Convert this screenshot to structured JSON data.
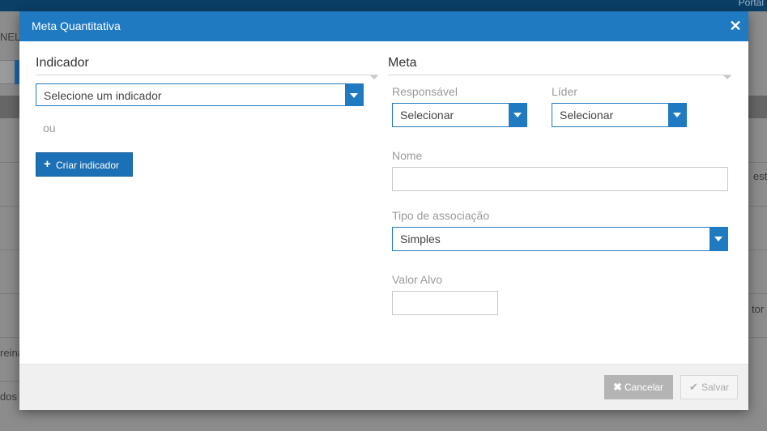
{
  "background": {
    "top_right_link": "Portal",
    "left_fragments": [
      "NEL",
      "reina",
      "dos"
    ],
    "right_fragments": [
      "esto",
      "tor"
    ]
  },
  "modal": {
    "title": "Meta Quantitativa",
    "close_icon": "close-icon",
    "indicator_section": {
      "title": "Indicador",
      "select_value": "Selecione um indicador",
      "or_text": "ou",
      "create_button_label": "Criar indicador",
      "create_button_icon": "plus-icon"
    },
    "goal_section": {
      "title": "Meta",
      "responsible_label": "Responsável",
      "responsible_value": "Selecionar",
      "leader_label": "Líder",
      "leader_value": "Selecionar",
      "name_label": "Nome",
      "name_value": "",
      "association_type_label": "Tipo de associação",
      "association_type_value": "Simples",
      "target_value_label": "Valor Alvo",
      "target_value_value": ""
    },
    "footer": {
      "cancel_label": "Cancelar",
      "cancel_icon": "times-icon",
      "save_label": "Salvar",
      "save_icon": "check-icon"
    }
  },
  "colors": {
    "primary": "#1f7ac2",
    "overlay": "#8c8c8c",
    "footer_bg": "#f0f0f0",
    "cancel_bg": "#b4b4b4"
  }
}
